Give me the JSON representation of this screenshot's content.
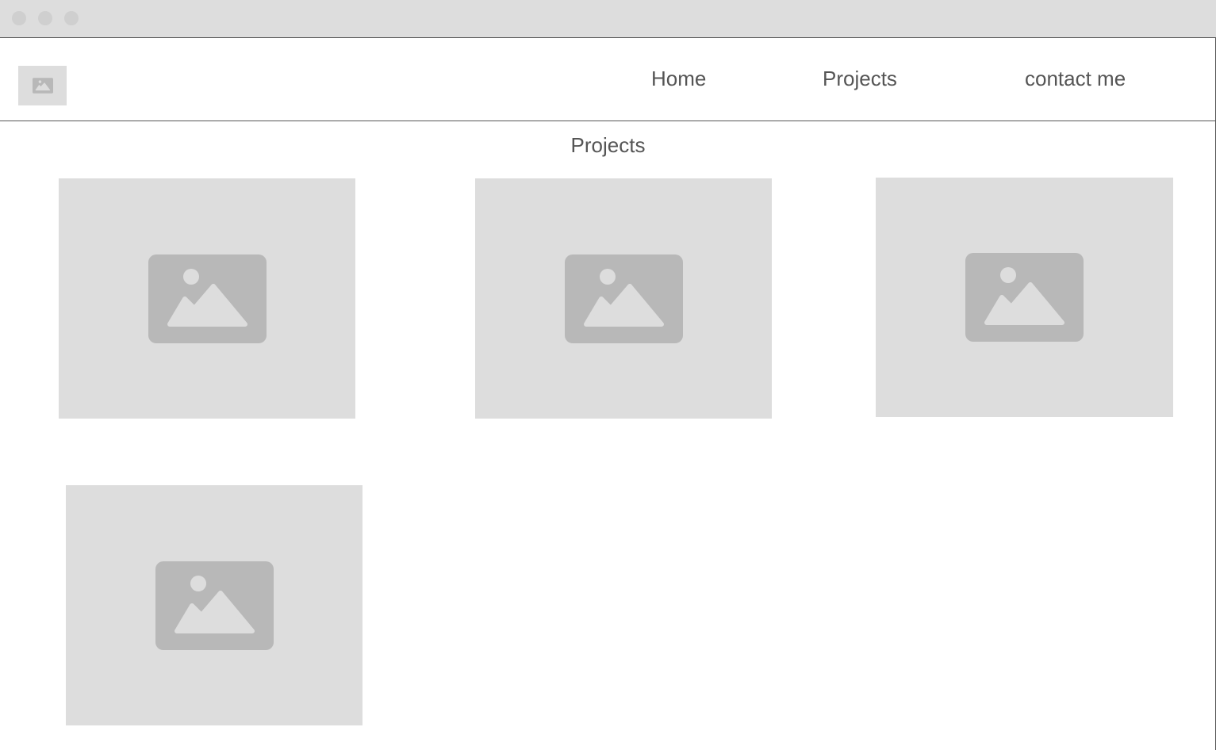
{
  "window": {
    "controls": [
      "close-dot",
      "minimize-dot",
      "maximize-dot"
    ]
  },
  "header": {
    "logo_icon": "image-placeholder-icon",
    "nav": {
      "home": "Home",
      "projects": "Projects",
      "contact": "contact me"
    }
  },
  "main": {
    "title": "Projects",
    "projects": [
      {
        "icon": "image-placeholder-icon"
      },
      {
        "icon": "image-placeholder-icon"
      },
      {
        "icon": "image-placeholder-icon"
      },
      {
        "icon": "image-placeholder-icon"
      }
    ]
  },
  "colors": {
    "placeholder_bg": "#dddddd",
    "placeholder_icon": "#b8b8b8",
    "text": "#555555",
    "border": "#555555"
  }
}
